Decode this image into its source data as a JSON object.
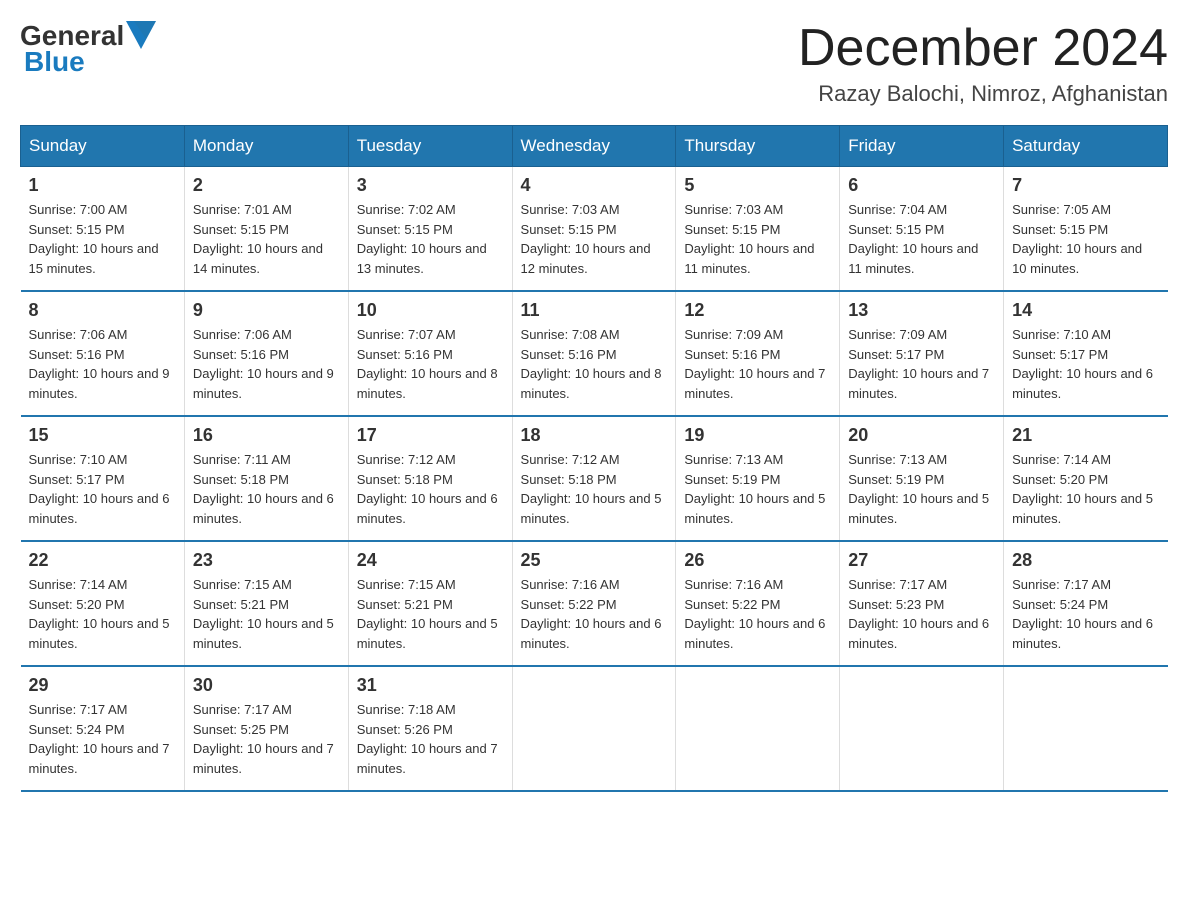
{
  "header": {
    "logo_general": "General",
    "logo_blue": "Blue",
    "month_title": "December 2024",
    "location": "Razay Balochi, Nimroz, Afghanistan"
  },
  "weekdays": [
    "Sunday",
    "Monday",
    "Tuesday",
    "Wednesday",
    "Thursday",
    "Friday",
    "Saturday"
  ],
  "weeks": [
    [
      {
        "day": "1",
        "sunrise": "7:00 AM",
        "sunset": "5:15 PM",
        "daylight": "10 hours and 15 minutes."
      },
      {
        "day": "2",
        "sunrise": "7:01 AM",
        "sunset": "5:15 PM",
        "daylight": "10 hours and 14 minutes."
      },
      {
        "day": "3",
        "sunrise": "7:02 AM",
        "sunset": "5:15 PM",
        "daylight": "10 hours and 13 minutes."
      },
      {
        "day": "4",
        "sunrise": "7:03 AM",
        "sunset": "5:15 PM",
        "daylight": "10 hours and 12 minutes."
      },
      {
        "day": "5",
        "sunrise": "7:03 AM",
        "sunset": "5:15 PM",
        "daylight": "10 hours and 11 minutes."
      },
      {
        "day": "6",
        "sunrise": "7:04 AM",
        "sunset": "5:15 PM",
        "daylight": "10 hours and 11 minutes."
      },
      {
        "day": "7",
        "sunrise": "7:05 AM",
        "sunset": "5:15 PM",
        "daylight": "10 hours and 10 minutes."
      }
    ],
    [
      {
        "day": "8",
        "sunrise": "7:06 AM",
        "sunset": "5:16 PM",
        "daylight": "10 hours and 9 minutes."
      },
      {
        "day": "9",
        "sunrise": "7:06 AM",
        "sunset": "5:16 PM",
        "daylight": "10 hours and 9 minutes."
      },
      {
        "day": "10",
        "sunrise": "7:07 AM",
        "sunset": "5:16 PM",
        "daylight": "10 hours and 8 minutes."
      },
      {
        "day": "11",
        "sunrise": "7:08 AM",
        "sunset": "5:16 PM",
        "daylight": "10 hours and 8 minutes."
      },
      {
        "day": "12",
        "sunrise": "7:09 AM",
        "sunset": "5:16 PM",
        "daylight": "10 hours and 7 minutes."
      },
      {
        "day": "13",
        "sunrise": "7:09 AM",
        "sunset": "5:17 PM",
        "daylight": "10 hours and 7 minutes."
      },
      {
        "day": "14",
        "sunrise": "7:10 AM",
        "sunset": "5:17 PM",
        "daylight": "10 hours and 6 minutes."
      }
    ],
    [
      {
        "day": "15",
        "sunrise": "7:10 AM",
        "sunset": "5:17 PM",
        "daylight": "10 hours and 6 minutes."
      },
      {
        "day": "16",
        "sunrise": "7:11 AM",
        "sunset": "5:18 PM",
        "daylight": "10 hours and 6 minutes."
      },
      {
        "day": "17",
        "sunrise": "7:12 AM",
        "sunset": "5:18 PM",
        "daylight": "10 hours and 6 minutes."
      },
      {
        "day": "18",
        "sunrise": "7:12 AM",
        "sunset": "5:18 PM",
        "daylight": "10 hours and 5 minutes."
      },
      {
        "day": "19",
        "sunrise": "7:13 AM",
        "sunset": "5:19 PM",
        "daylight": "10 hours and 5 minutes."
      },
      {
        "day": "20",
        "sunrise": "7:13 AM",
        "sunset": "5:19 PM",
        "daylight": "10 hours and 5 minutes."
      },
      {
        "day": "21",
        "sunrise": "7:14 AM",
        "sunset": "5:20 PM",
        "daylight": "10 hours and 5 minutes."
      }
    ],
    [
      {
        "day": "22",
        "sunrise": "7:14 AM",
        "sunset": "5:20 PM",
        "daylight": "10 hours and 5 minutes."
      },
      {
        "day": "23",
        "sunrise": "7:15 AM",
        "sunset": "5:21 PM",
        "daylight": "10 hours and 5 minutes."
      },
      {
        "day": "24",
        "sunrise": "7:15 AM",
        "sunset": "5:21 PM",
        "daylight": "10 hours and 5 minutes."
      },
      {
        "day": "25",
        "sunrise": "7:16 AM",
        "sunset": "5:22 PM",
        "daylight": "10 hours and 6 minutes."
      },
      {
        "day": "26",
        "sunrise": "7:16 AM",
        "sunset": "5:22 PM",
        "daylight": "10 hours and 6 minutes."
      },
      {
        "day": "27",
        "sunrise": "7:17 AM",
        "sunset": "5:23 PM",
        "daylight": "10 hours and 6 minutes."
      },
      {
        "day": "28",
        "sunrise": "7:17 AM",
        "sunset": "5:24 PM",
        "daylight": "10 hours and 6 minutes."
      }
    ],
    [
      {
        "day": "29",
        "sunrise": "7:17 AM",
        "sunset": "5:24 PM",
        "daylight": "10 hours and 7 minutes."
      },
      {
        "day": "30",
        "sunrise": "7:17 AM",
        "sunset": "5:25 PM",
        "daylight": "10 hours and 7 minutes."
      },
      {
        "day": "31",
        "sunrise": "7:18 AM",
        "sunset": "5:26 PM",
        "daylight": "10 hours and 7 minutes."
      },
      null,
      null,
      null,
      null
    ]
  ]
}
